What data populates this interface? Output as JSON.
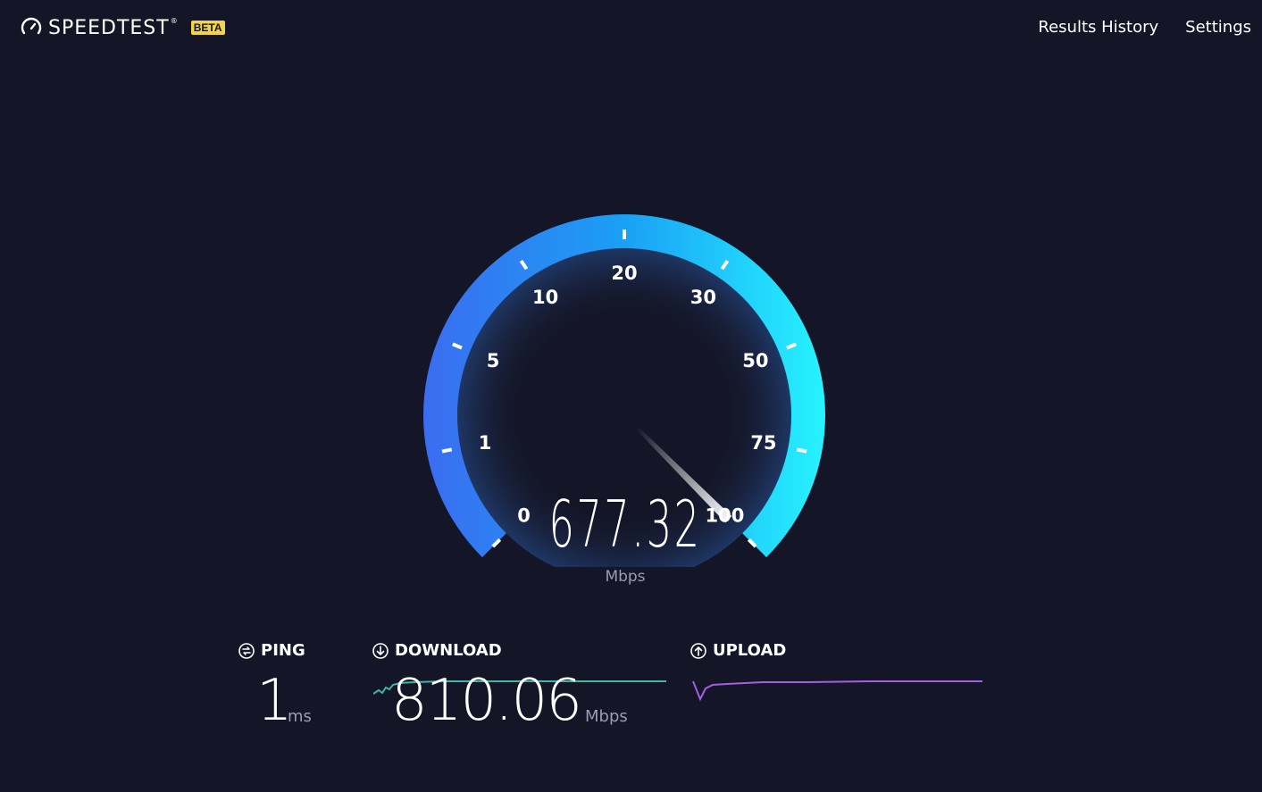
{
  "header": {
    "brand_name": "SPEEDTEST",
    "brand_tm": "®",
    "beta_label": "BETA",
    "nav": {
      "results_history": "Results History",
      "settings": "Settings"
    }
  },
  "gauge": {
    "scale_labels": [
      "0",
      "1",
      "5",
      "10",
      "20",
      "30",
      "50",
      "75",
      "100"
    ],
    "needle_position_fraction": 1.0,
    "current_speed": "677.32",
    "current_unit": "Mbps",
    "colors": {
      "arc_start": "#3b6cf0",
      "arc_end": "#26f3ff"
    }
  },
  "results": {
    "ping": {
      "label": "PING",
      "value": "1",
      "unit": "ms",
      "icon": "ping-icon"
    },
    "download": {
      "label": "DOWNLOAD",
      "value": "810.06",
      "unit": "Mbps",
      "icon": "download-icon",
      "line_color": "#3bb7a6"
    },
    "upload": {
      "label": "UPLOAD",
      "value": "",
      "unit": "",
      "icon": "upload-icon",
      "line_color": "#a45ee6"
    }
  }
}
